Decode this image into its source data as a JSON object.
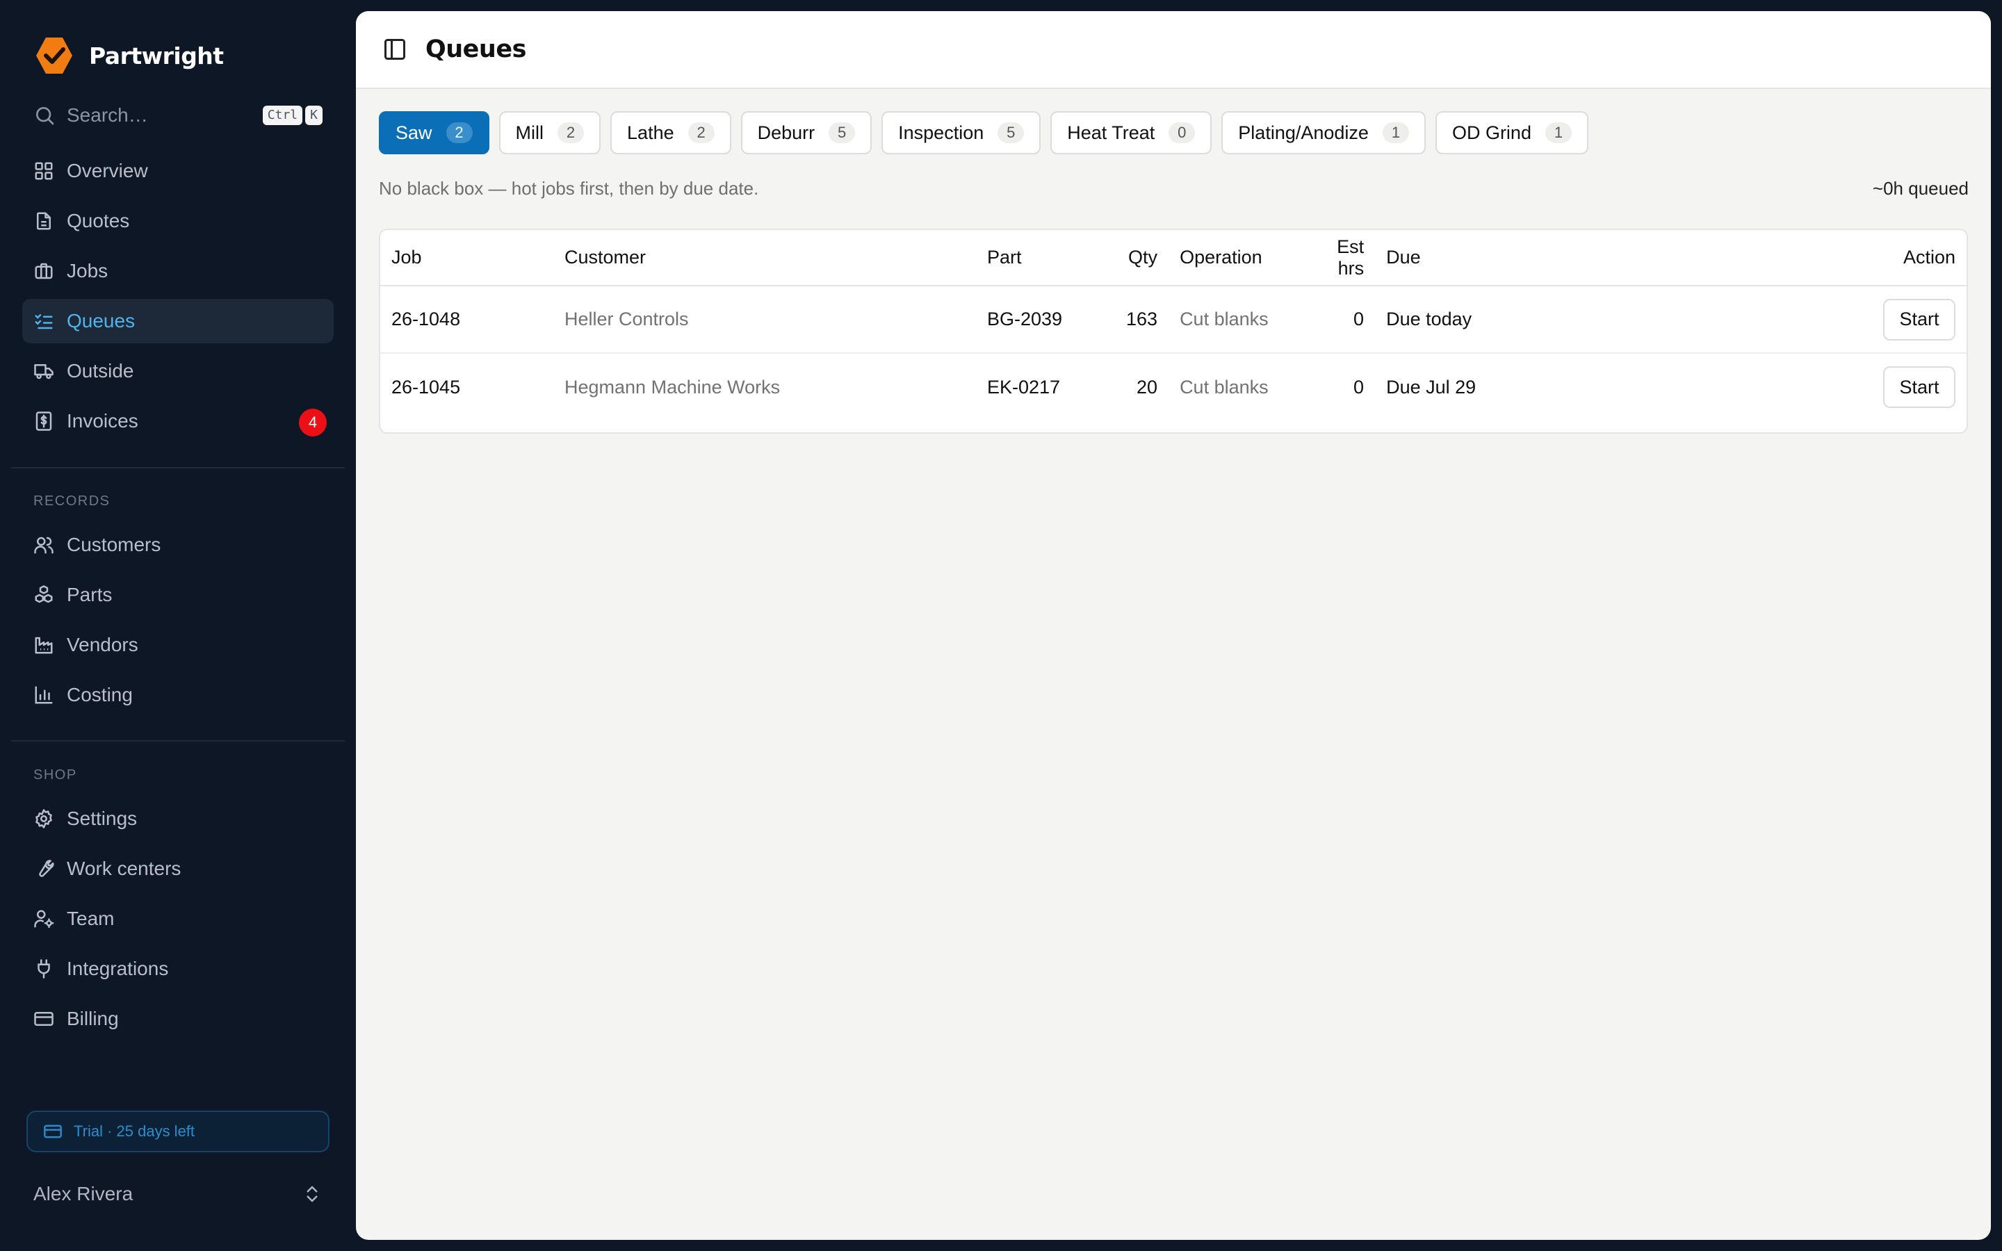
{
  "app": {
    "name": "Partwright",
    "accent": "#0a6fb6",
    "logo_color": "#f07c12"
  },
  "search": {
    "label": "Search…",
    "shortcut_ctrl": "Ctrl",
    "shortcut_key": "K"
  },
  "nav": {
    "main": [
      {
        "label": "Overview",
        "icon": "grid-icon"
      },
      {
        "label": "Quotes",
        "icon": "document-icon"
      },
      {
        "label": "Jobs",
        "icon": "briefcase-icon"
      },
      {
        "label": "Queues",
        "icon": "list-checks-icon",
        "active": true
      },
      {
        "label": "Outside",
        "icon": "truck-icon"
      },
      {
        "label": "Invoices",
        "icon": "receipt-icon",
        "badge": "4"
      }
    ],
    "records_label": "RECORDS",
    "records": [
      {
        "label": "Customers",
        "icon": "users-icon"
      },
      {
        "label": "Parts",
        "icon": "boxes-icon"
      },
      {
        "label": "Vendors",
        "icon": "factory-icon"
      },
      {
        "label": "Costing",
        "icon": "bar-chart-icon"
      }
    ],
    "shop_label": "SHOP",
    "shop": [
      {
        "label": "Settings",
        "icon": "gear-icon"
      },
      {
        "label": "Work centers",
        "icon": "wrench-icon"
      },
      {
        "label": "Team",
        "icon": "user-cog-icon"
      },
      {
        "label": "Integrations",
        "icon": "plug-icon"
      },
      {
        "label": "Billing",
        "icon": "credit-card-icon"
      }
    ]
  },
  "trial": {
    "label": "Trial · 25 days left"
  },
  "user": {
    "name": "Alex Rivera"
  },
  "page": {
    "title": "Queues"
  },
  "tabs": [
    {
      "label": "Saw",
      "count": "2",
      "active": true
    },
    {
      "label": "Mill",
      "count": "2"
    },
    {
      "label": "Lathe",
      "count": "2"
    },
    {
      "label": "Deburr",
      "count": "5"
    },
    {
      "label": "Inspection",
      "count": "5"
    },
    {
      "label": "Heat Treat",
      "count": "0"
    },
    {
      "label": "Plating/Anodize",
      "count": "1"
    },
    {
      "label": "OD Grind",
      "count": "1"
    }
  ],
  "queue": {
    "hint": "No black box — hot jobs first, then by due date.",
    "queued": "~0h queued"
  },
  "table": {
    "headers": {
      "job": "Job",
      "customer": "Customer",
      "part": "Part",
      "qty": "Qty",
      "operation": "Operation",
      "est_hrs": "Est hrs",
      "due": "Due",
      "action": "Action"
    },
    "rows": [
      {
        "job": "26-1048",
        "customer": "Heller Controls",
        "part": "BG-2039",
        "qty": "163",
        "operation": "Cut blanks",
        "est_hrs": "0",
        "due": "Due today",
        "action": "Start"
      },
      {
        "job": "26-1045",
        "customer": "Hegmann Machine Works",
        "part": "EK-0217",
        "qty": "20",
        "operation": "Cut blanks",
        "est_hrs": "0",
        "due": "Due Jul 29",
        "action": "Start"
      }
    ]
  }
}
